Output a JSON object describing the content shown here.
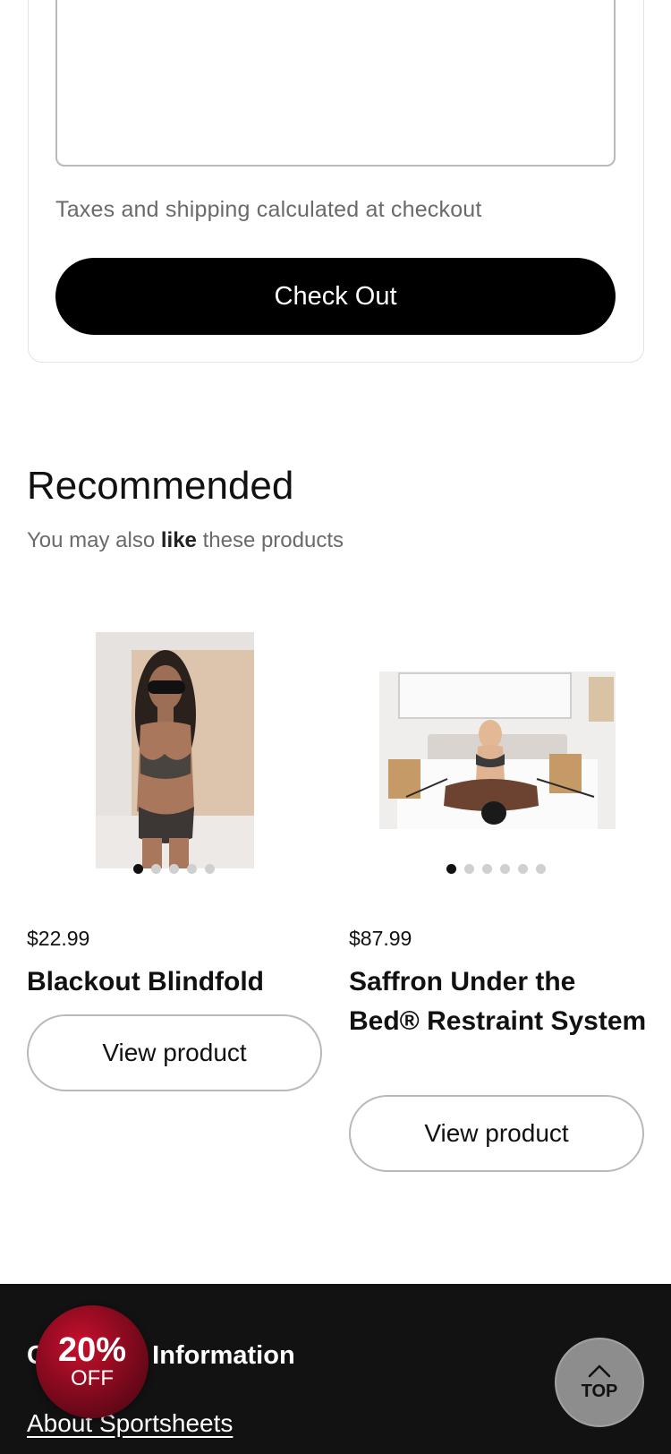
{
  "cart": {
    "note_value": "",
    "tax_note": "Taxes and shipping calculated at checkout",
    "checkout_label": "Check Out"
  },
  "recommended": {
    "title": "Recommended",
    "subtitle_pre": "You may also ",
    "subtitle_bold": "like",
    "subtitle_post": " these products",
    "products": [
      {
        "price": "$22.99",
        "name": "Blackout Blindfold",
        "button_label": "View product",
        "image_count": 5,
        "active_image": 1
      },
      {
        "price": "$87.99",
        "name": "Saffron Under the Bed® Restraint System",
        "button_label": "View product",
        "image_count": 6,
        "active_image": 1
      }
    ]
  },
  "footer": {
    "heading": "Company Information",
    "link": "About Sportsheets"
  },
  "promo": {
    "percent": "20%",
    "off": "OFF"
  },
  "back_to_top": {
    "label": "TOP",
    "icon": "chevron-up-icon"
  },
  "colors": {
    "checkout_bg": "#000000",
    "footer_bg": "#121212",
    "promo_red": "#c8102e",
    "top_button": "#8d8d8d"
  }
}
